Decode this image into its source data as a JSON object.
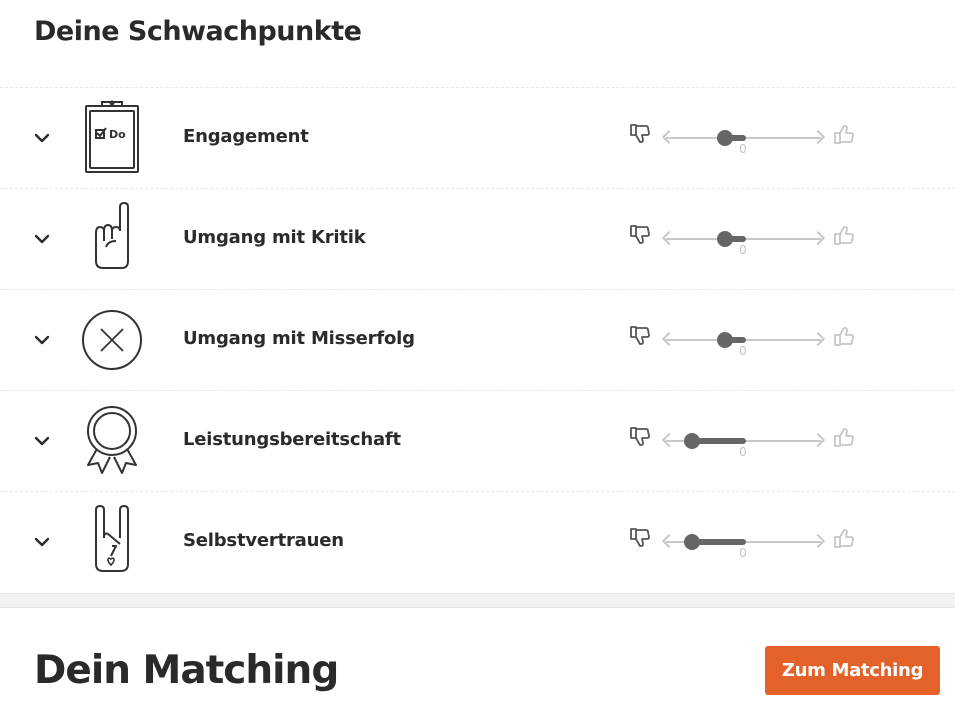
{
  "weaknesses": {
    "title": "Deine Schwachpunkte",
    "items": [
      {
        "label": "Engagement",
        "icon": "clipboard-todo-icon",
        "icon_text": "Do",
        "value": "0",
        "level": 0.38
      },
      {
        "label": "Umgang mit Kritik",
        "icon": "raised-index-finger-icon",
        "value": "0",
        "level": 0.38
      },
      {
        "label": "Umgang mit Misserfolg",
        "icon": "x-circle-icon",
        "value": "0",
        "level": 0.38
      },
      {
        "label": "Leistungsbereitschaft",
        "icon": "award-ribbon-icon",
        "value": "0",
        "level": 0.17
      },
      {
        "label": "Selbstvertrauen",
        "icon": "rock-hand-icon",
        "value": "0",
        "level": 0.17
      }
    ]
  },
  "matching": {
    "title": "Dein Matching",
    "button_label": "Zum Matching"
  },
  "colors": {
    "accent": "#e2622a",
    "text": "#2b2b2b",
    "slider_fill": "#666666",
    "slider_track": "#c8c8c8"
  }
}
